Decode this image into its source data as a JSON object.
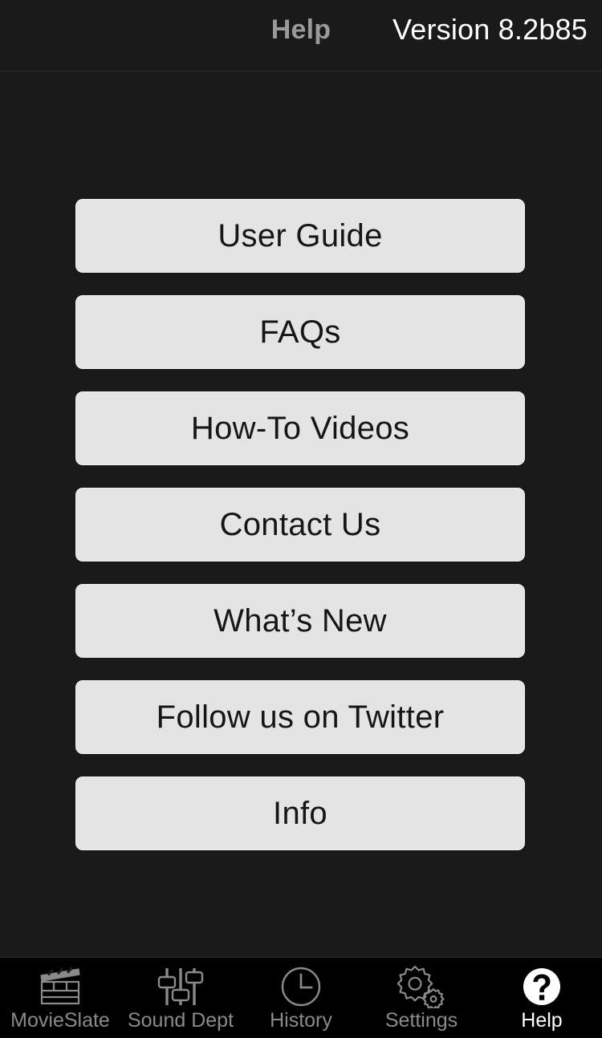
{
  "header": {
    "title": "Help",
    "version": "Version 8.2b85",
    "title_color": "#9a9a9a",
    "version_color": "#ffffff"
  },
  "menu": {
    "items": [
      {
        "label": "User Guide",
        "icon": "document-icon"
      },
      {
        "label": "FAQs",
        "icon": "question-icon"
      },
      {
        "label": "How-To Videos",
        "icon": "video-icon"
      },
      {
        "label": "Contact Us",
        "icon": "mail-icon"
      },
      {
        "label": "What’s New",
        "icon": "star-icon"
      },
      {
        "label": "Follow us on Twitter",
        "icon": "twitter-icon"
      },
      {
        "label": "Info",
        "icon": "info-icon"
      }
    ],
    "button_background": "#e4e4e4",
    "button_text_color": "#161616"
  },
  "tabbar": {
    "background": "#000000",
    "inactive_color": "#8a8a8a",
    "active_color": "#ffffff",
    "items": [
      {
        "label": "MovieSlate",
        "icon": "clapperboard-icon",
        "active": false
      },
      {
        "label": "Sound Dept",
        "icon": "sliders-icon",
        "active": false
      },
      {
        "label": "History",
        "icon": "clock-icon",
        "active": false
      },
      {
        "label": "Settings",
        "icon": "gears-icon",
        "active": false
      },
      {
        "label": "Help",
        "icon": "question-circle-icon",
        "active": true
      }
    ]
  },
  "page": {
    "background": "#1a1a1a"
  }
}
